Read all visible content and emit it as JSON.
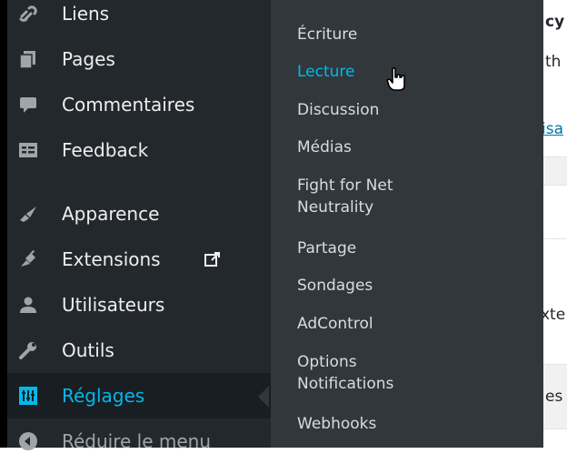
{
  "sidebar": {
    "items": [
      {
        "label": "Liens",
        "icon": "link-icon"
      },
      {
        "label": "Pages",
        "icon": "pages-icon"
      },
      {
        "label": "Commentaires",
        "icon": "comment-icon"
      },
      {
        "label": "Feedback",
        "icon": "feedback-icon"
      },
      {
        "label": "Apparence",
        "icon": "appearance-brush-icon"
      },
      {
        "label": "Extensions",
        "icon": "plugins-icon",
        "extra_icon": "external-link-icon"
      },
      {
        "label": "Utilisateurs",
        "icon": "users-icon"
      },
      {
        "label": "Outils",
        "icon": "tools-wrench-icon"
      },
      {
        "label": "Réglages",
        "icon": "settings-icon",
        "state": "current"
      },
      {
        "label": "Réduire le menu",
        "icon": "collapse-icon"
      }
    ]
  },
  "submenu": {
    "items": [
      {
        "label": "Écriture"
      },
      {
        "label": "Lecture",
        "state": "hover"
      },
      {
        "label": "Discussion"
      },
      {
        "label": "Médias"
      },
      {
        "label": "Fight for Net\nNeutrality"
      },
      {
        "label": "Partage"
      },
      {
        "label": "Sondages"
      },
      {
        "label": "AdControl"
      },
      {
        "label": "Options\nNotifications"
      },
      {
        "label": "Webhooks"
      }
    ]
  },
  "content": {
    "fragments": [
      "cy",
      "th",
      "isa",
      "xte",
      "es"
    ]
  },
  "colors": {
    "sidebar_bg": "#23282d",
    "submenu_bg": "#32373c",
    "accent": "#00b9eb",
    "text": "#eeeeee"
  }
}
